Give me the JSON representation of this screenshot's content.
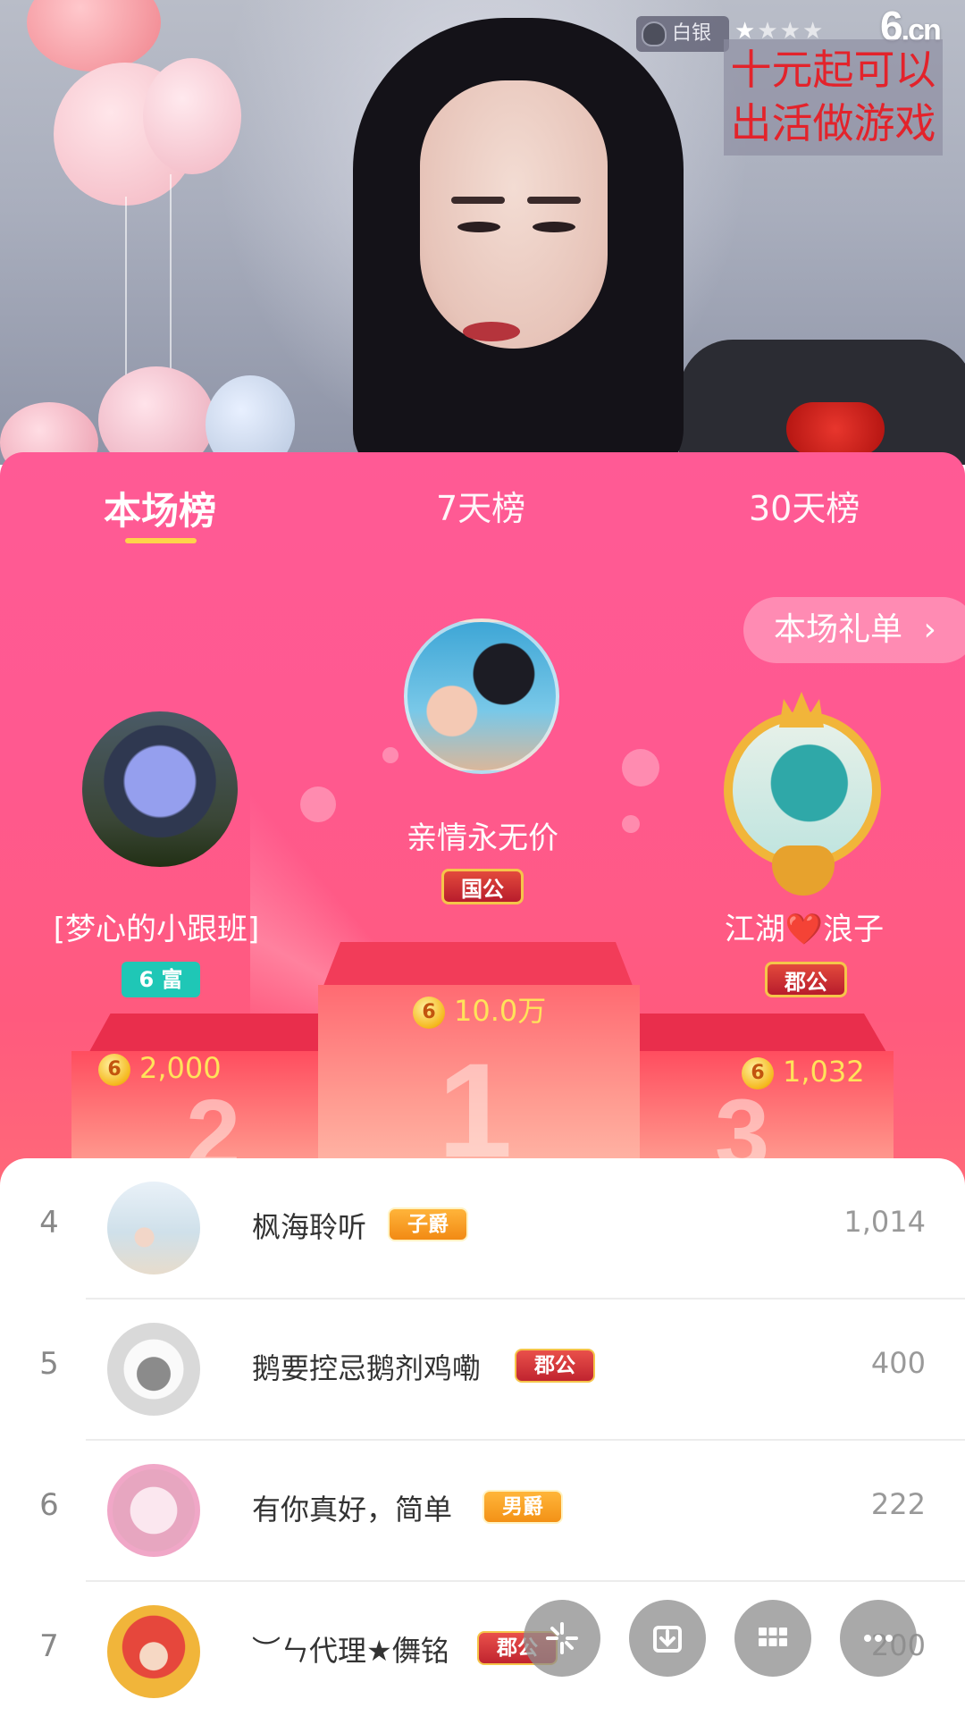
{
  "video": {
    "level_label": "白银",
    "stars_filled": 1,
    "stars_total": 4,
    "logo_main": "6",
    "logo_suffix": ".cn",
    "promo_line1": "十元起可以",
    "promo_line2": "出活做游戏"
  },
  "tabs": [
    {
      "label": "本场榜",
      "active": true
    },
    {
      "label": "7天榜",
      "active": false
    },
    {
      "label": "30天榜",
      "active": false
    }
  ],
  "gift_list_button": {
    "label": "本场礼单",
    "chevron": "›"
  },
  "podium": {
    "first": {
      "rank_number": "1",
      "name": "亲情永无价",
      "badge": "国公",
      "coins": "10.0万"
    },
    "second": {
      "rank_number": "2",
      "name": "[梦心的小跟班]",
      "badge": "6 富",
      "coins": "2,000"
    },
    "third": {
      "rank_number": "3",
      "name": "江湖❤️浪子",
      "badge": "郡公",
      "coins": "1,032"
    }
  },
  "coin_symbol": "6",
  "list": [
    {
      "rank": "4",
      "name": "枫海聆听",
      "badge": "子爵",
      "badge_style": "zijue",
      "value": "1,014"
    },
    {
      "rank": "5",
      "name": "鹅要控忌鹅剂鸡嘞",
      "badge": "郡公",
      "badge_style": "jungong",
      "value": "400"
    },
    {
      "rank": "6",
      "name": "有你真好，简单",
      "badge": "男爵",
      "badge_style": "nanjue",
      "value": "222"
    },
    {
      "rank": "7",
      "name": "︶ㄣ代理★儛铭",
      "badge": "郡公",
      "badge_style": "jungong",
      "value": "200"
    }
  ],
  "floating_buttons": [
    {
      "icon": "sparkle-icon"
    },
    {
      "icon": "download-icon"
    },
    {
      "icon": "grid-icon"
    },
    {
      "icon": "more-icon"
    }
  ],
  "colors": {
    "panel_pink": "#ff5a95",
    "tab_underline": "#ffd34a",
    "coin_text": "#ffe35a"
  }
}
